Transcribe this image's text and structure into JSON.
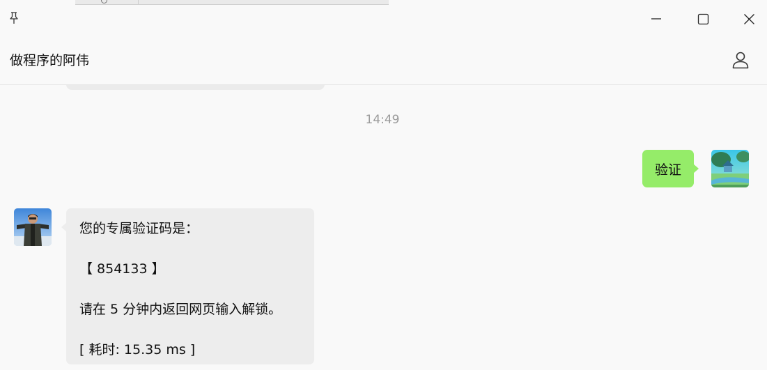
{
  "window": {
    "pin_icon": "pin-icon",
    "minimize_icon": "minimize-icon",
    "maximize_icon": "maximize-icon",
    "close_icon": "close-icon"
  },
  "header": {
    "title": "做程序的阿伟",
    "profile_icon": "person-icon"
  },
  "chat": {
    "timestamp": "14:49",
    "outgoing": {
      "text": "验证",
      "bubble_color": "#95ec69"
    },
    "incoming": {
      "lines": [
        "您的专属验证码是：",
        "【 854133 】",
        "请在 5 分钟内返回网页输入解锁。",
        "[ 耗时: 15.35 ms ]"
      ],
      "bubble_color": "#ededed"
    }
  },
  "colors": {
    "background": "#f9f9f9",
    "timestamp": "#9a9a9a"
  }
}
